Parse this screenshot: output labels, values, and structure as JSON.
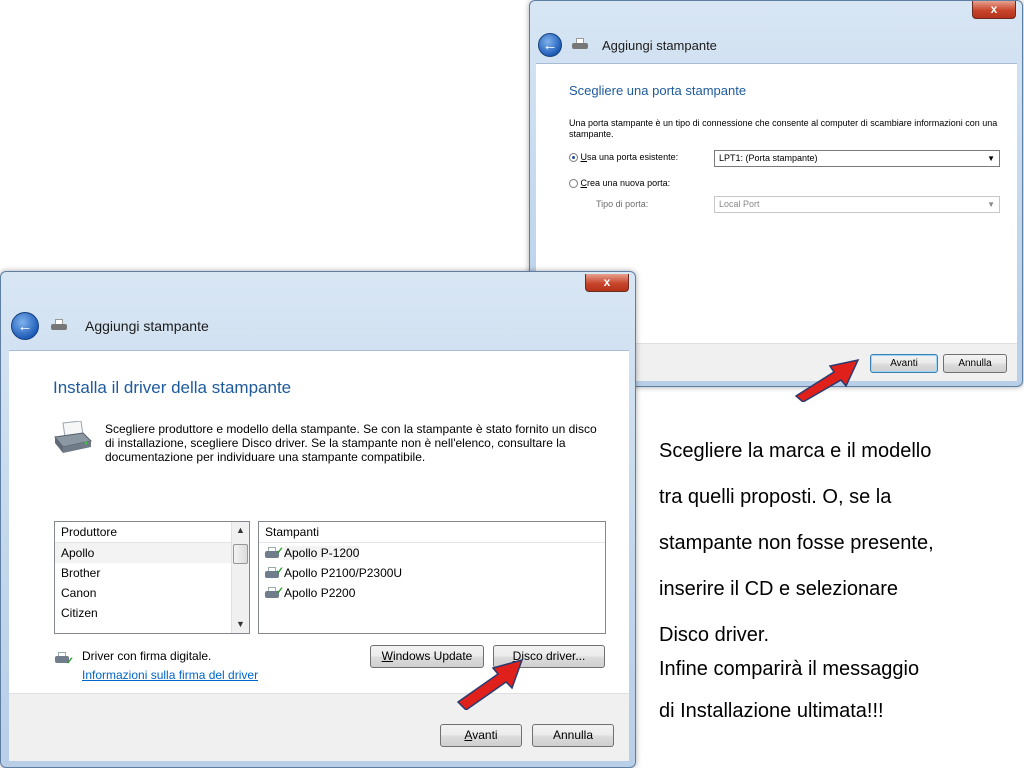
{
  "window_port": {
    "title": "Aggiungi stampante",
    "close_label": "x",
    "heading": "Scegliere una porta stampante",
    "description": "Una porta stampante è un tipo di connessione che consente al computer di scambiare informazioni con una stampante.",
    "radio_existing_label": "Usa una porta esistente:",
    "radio_existing_accel": "U",
    "radio_existing_rest": "sa una porta esistente:",
    "existing_port_value": "LPT1: (Porta stampante)",
    "radio_new_accel": "C",
    "radio_new_rest": "rea una nuova porta:",
    "port_type_label": "Tipo di porta:",
    "port_type_value": "Local Port",
    "next_label": "Avanti",
    "cancel_label": "Annulla"
  },
  "window_driver": {
    "title": "Aggiungi stampante",
    "close_label": "x",
    "heading": "Installa il driver della stampante",
    "description": "Scegliere produttore e modello della stampante. Se con la stampante è stato fornito un disco di installazione, scegliere Disco driver. Se la stampante non è nell'elenco, consultare la documentazione per individuare una stampante compatibile.",
    "manufacturer_header": "Produttore",
    "manufacturers": [
      "Apollo",
      "Brother",
      "Canon",
      "Citizen"
    ],
    "printers_header": "Stampanti",
    "printers": [
      "Apollo P-1200",
      "Apollo P2100/P2300U",
      "Apollo P2200"
    ],
    "signed_driver_text": "Driver con firma digitale.",
    "signature_info_link": "Informazioni sulla firma del driver",
    "windows_update_accel": "W",
    "windows_update_rest": "indows Update",
    "have_disk_accel": "D",
    "have_disk_rest": "isco driver...",
    "next_accel": "A",
    "next_rest": "vanti",
    "cancel_label": "Annulla"
  },
  "side_text": [
    "Scegliere la marca e il modello",
    "tra quelli proposti. O, se la",
    "stampante non fosse presente,",
    "inserire il CD e selezionare",
    "Disco driver.",
    "Infine comparirà il messaggio",
    "di Installazione ultimata!!!"
  ],
  "colors": {
    "heading_blue": "#1d5a9c",
    "arrow_red": "#e0201a",
    "link_blue": "#0066cc"
  }
}
